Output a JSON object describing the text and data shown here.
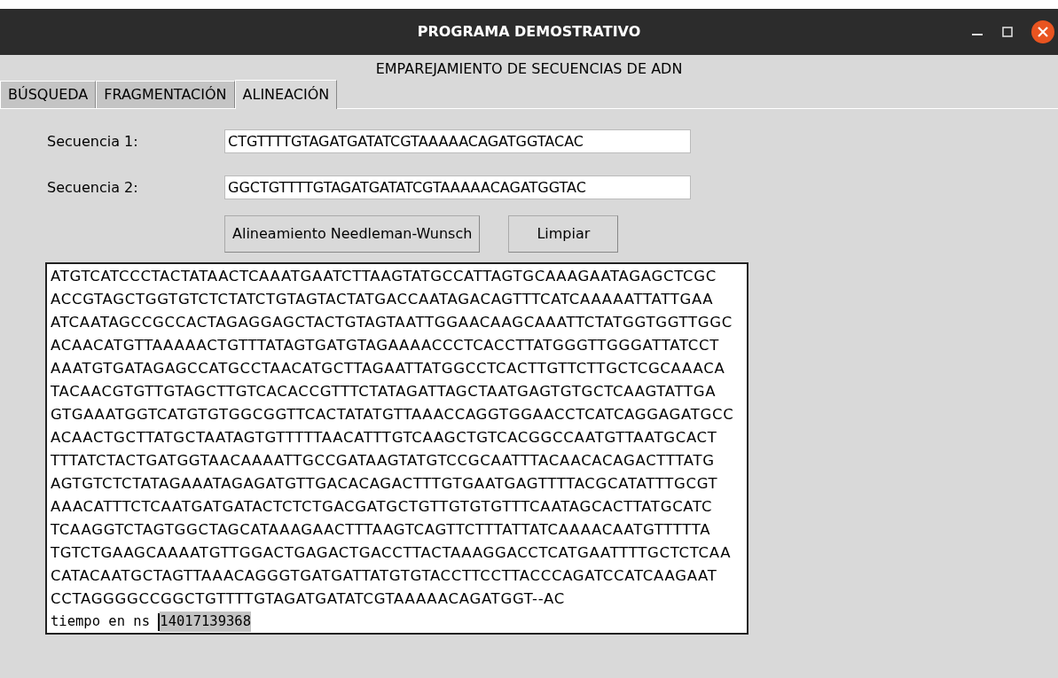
{
  "window": {
    "title": "PROGRAMA DEMOSTRATIVO"
  },
  "header": "EMPAREJAMIENTO DE SECUENCIAS DE ADN",
  "tabs": [
    {
      "label": "BÚSQUEDA",
      "selected": false
    },
    {
      "label": "FRAGMENTACIÓN",
      "selected": false
    },
    {
      "label": "ALINEACIÓN",
      "selected": true
    }
  ],
  "fields": [
    {
      "label": "Secuencia 1:",
      "value": "CTGTTTTGTAGATGATATCGTAAAAACAGATGGTACAC"
    },
    {
      "label": "Secuencia 2:",
      "value": "GGCTGTTTTGTAGATGATATCGTAAAAACAGATGGTAC"
    }
  ],
  "buttons": [
    "Alineamiento Needleman-Wunsch",
    "Limpiar"
  ],
  "output": {
    "lines": [
      "ATGTCATCCCTACTATAACTCAAATGAATCTTAAGTATGCCATTAGTGCAAAGAATAGAGCTCGC",
      "ACCGTAGCTGGTGTCTCTATCTGTAGTACTATGACCAATAGACAGTTTCATCAAAAATTATTGAA",
      "ATCAATAGCCGCCACTAGAGGAGCTACTGTAGTAATTGGAACAAGCAAATTCTATGGTGGTTGGC",
      "ACAACATGTTAAAAACTGTTTATAGTGATGTAGAAAACCCTCACCTTATGGGTTGGGATTATCCT",
      "AAATGTGATAGAGCCATGCCTAACATGCTTAGAATTATGGCCTCACTTGTTCTTGCTCGCAAACA",
      "TACAACGTGTTGTAGCTTGTCACACCGTTTCTATAGATTAGCTAATGAGTGTGCTCAAGTATTGA",
      "GTGAAATGGTCATGTGTGGCGGTTCACTATATGTTAAACCAGGTGGAACCTCATCAGGAGATGCC",
      "ACAACTGCTTATGCTAATAGTGTTTTTAACATTTGTCAAGCTGTCACGGCCAATGTTAATGCACT",
      "TTTATCTACTGATGGTAACAAAATTGCCGATAAGTATGTCCGCAATTTACAACACAGACTTTATG",
      "AGTGTCTCTATAGAAATAGAGATGTTGACACAGACTTTGTGAATGAGTTTTACGCATATTTGCGT",
      "AAACATTTCTCAATGATGATACTCTCTGACGATGCTGTTGTGTGTTTCAATAGCACTTATGCATC",
      "TCAAGGTCTAGTGGCTAGCATAAAGAACTTTAAGTCAGTTCTTTATTATCAAAACAATGTTTTTA",
      "TGTCTGAAGCAAAATGTTGGACTGAGACTGACCTTACTAAAGGACCTCATGAATTTTGCTCTCAA",
      "CATACAATGCTAGTTAAACAGGGTGATGATTATGTGTACCTTCCTTACCCAGATCCATCAAGAAT",
      "CCTAGGGGCCGGCTGTTTTGTAGATGATATCGTAAAAACAGATGGT--AC"
    ],
    "timing": {
      "label": "tiempo en ns",
      "value": "14017139368",
      "selected": true
    }
  }
}
